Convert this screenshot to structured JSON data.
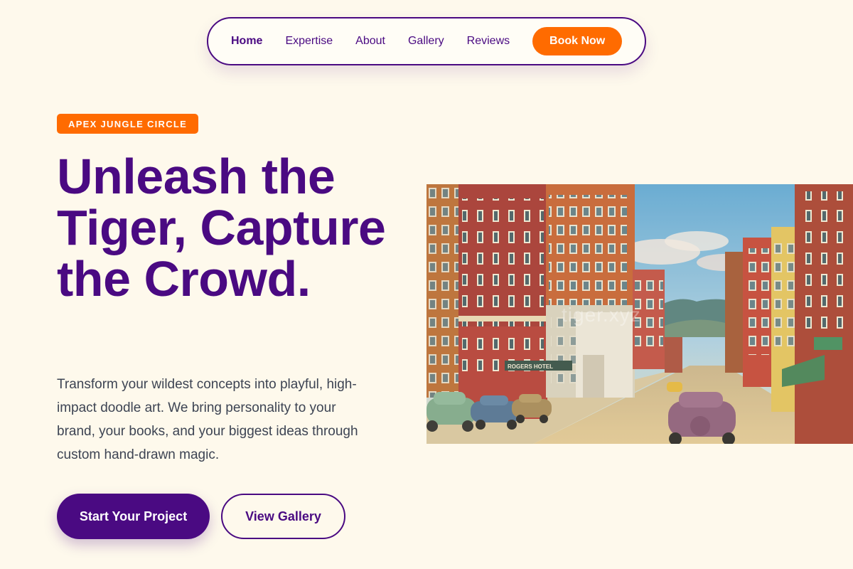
{
  "nav": {
    "links": [
      {
        "label": "Home",
        "active": true
      },
      {
        "label": "Expertise"
      },
      {
        "label": "About"
      },
      {
        "label": "Gallery"
      },
      {
        "label": "Reviews"
      }
    ],
    "cta_label": "Book Now"
  },
  "hero": {
    "badge": "APEX JUNGLE CIRCLE",
    "headline": "Unleash the Tiger, Capture the Crowd.",
    "subtext": "Transform your wildest concepts into playful, high-impact doodle art. We bring personality to your brand, your books, and your biggest ideas through custom hand-drawn magic.",
    "primary_button": "Start Your Project",
    "secondary_button": "View Gallery"
  },
  "image": {
    "watermark": "tiger.xyz",
    "sign_hotel": "ROGERS HOTEL"
  },
  "colors": {
    "background": "#fef9ec",
    "brand_purple": "#4a0a82",
    "accent_orange": "#ff6b00",
    "body_text": "#3d4453"
  }
}
